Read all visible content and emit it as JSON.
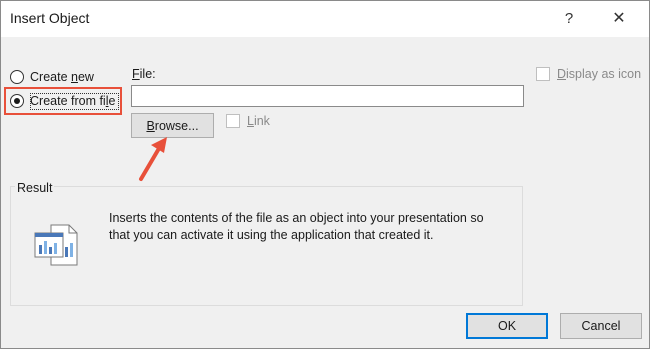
{
  "window": {
    "title": "Insert Object",
    "help_glyph": "?",
    "close_glyph": "✕"
  },
  "options": {
    "create_new": {
      "pre": "Create ",
      "key": "n",
      "post": "ew",
      "selected": false
    },
    "create_from_file": {
      "pre": "Create from fi",
      "key": "l",
      "post": "e",
      "selected": true
    }
  },
  "file": {
    "label_key": "F",
    "label_post": "ile:",
    "value": "",
    "browse_key": "B",
    "browse_post": "rowse..."
  },
  "link": {
    "key": "L",
    "post": "ink",
    "checked": false,
    "enabled": false
  },
  "display_as_icon": {
    "key": "D",
    "post": "isplay as icon",
    "checked": false,
    "enabled": false
  },
  "result": {
    "legend": "Result",
    "icon": "object-file-icon",
    "text_line1": "Inserts the contents of the file as an object into your presentation so",
    "text_line2": "that you can activate it using the application that created it."
  },
  "buttons": {
    "ok": "OK",
    "cancel": "Cancel"
  },
  "annotation": {
    "icon": "arrow-annotation-icon",
    "color": "#e8503a"
  },
  "colors": {
    "accent": "#0078d7",
    "highlight": "#e8503a"
  }
}
